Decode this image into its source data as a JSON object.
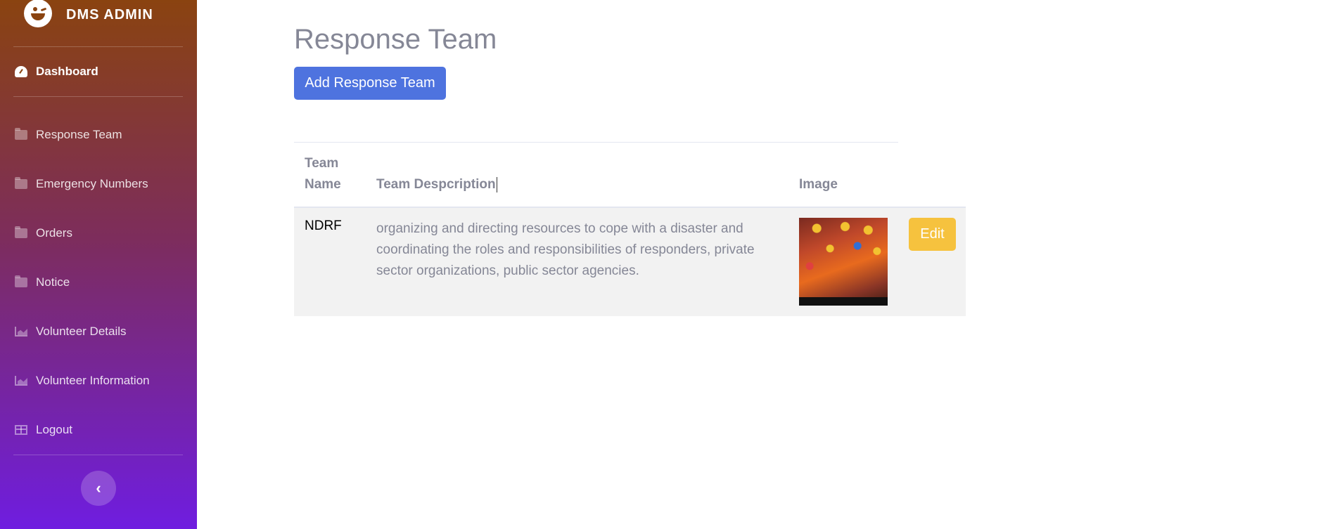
{
  "sidebar": {
    "brand": "DMS ADMIN",
    "dashboard_label": "Dashboard",
    "items": [
      {
        "label": "Response Team",
        "icon": "folder-icon"
      },
      {
        "label": "Emergency Numbers",
        "icon": "folder-icon"
      },
      {
        "label": "Orders",
        "icon": "folder-icon"
      },
      {
        "label": "Notice",
        "icon": "folder-icon"
      },
      {
        "label": "Volunteer Details",
        "icon": "area-chart-icon"
      },
      {
        "label": "Volunteer Information",
        "icon": "area-chart-icon"
      },
      {
        "label": "Logout",
        "icon": "table-icon"
      }
    ],
    "collapse_glyph": "‹"
  },
  "main": {
    "title": "Response Team",
    "add_button": "Add Response Team",
    "table": {
      "headers": {
        "name_line1": "Team",
        "name_line2": "Name",
        "description": "Team Despcription",
        "image": "Image"
      },
      "rows": [
        {
          "name": "NDRF",
          "description": "organizing and directing resources to cope with a disaster and coordinating the roles and responsibilities of responders, private sector organizations, public sector agencies.",
          "edit_label": "Edit"
        }
      ]
    }
  },
  "colors": {
    "primary": "#4e73df",
    "warning": "#f6c23e",
    "text_muted": "#858796",
    "sidebar_top": "#8a4310",
    "sidebar_bottom": "#6f1de0"
  }
}
